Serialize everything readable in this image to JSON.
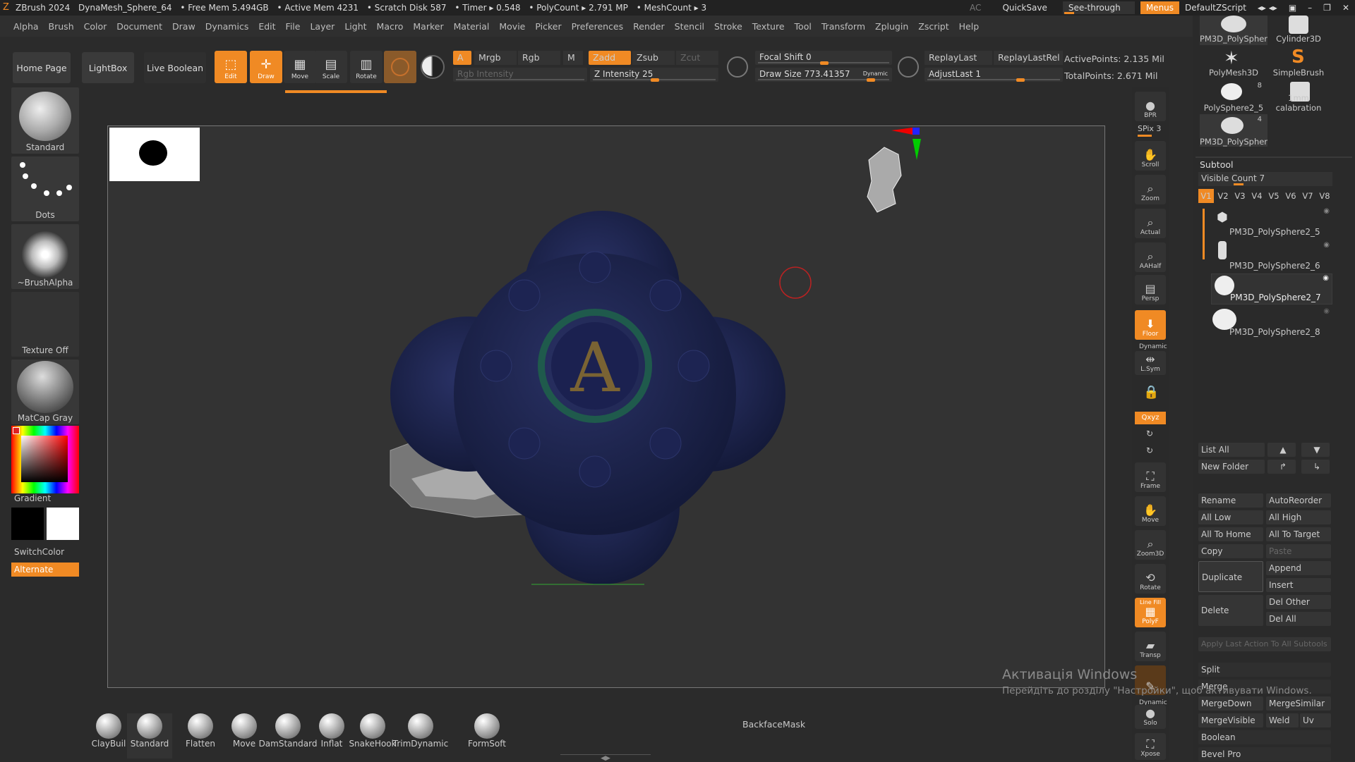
{
  "titlebar": {
    "app": "ZBrush 2024",
    "doc": "DynaMesh_Sphere_64",
    "free_mem": "• Free Mem 5.494GB",
    "active_mem": "• Active Mem 4231",
    "scratch": "• Scratch Disk 587",
    "timer": "• Timer ▸ 0.548",
    "polycount": "• PolyCount ▸ 2.791 MP",
    "meshcount": "• MeshCount ▸ 3",
    "ac": "AC",
    "quicksave": "QuickSave",
    "see_through": "See-through",
    "see_through_value": "0",
    "menus": "Menus",
    "zscript": "DefaultZScript"
  },
  "menu": [
    "Alpha",
    "Brush",
    "Color",
    "Document",
    "Draw",
    "Dynamics",
    "Edit",
    "File",
    "Layer",
    "Light",
    "Macro",
    "Marker",
    "Material",
    "Movie",
    "Picker",
    "Preferences",
    "Render",
    "Stencil",
    "Stroke",
    "Texture",
    "Tool",
    "Transform",
    "Zplugin",
    "Zscript",
    "Help"
  ],
  "shelf": {
    "home": "Home Page",
    "lightbox": "LightBox",
    "liveboolean": "Live Boolean",
    "tools": [
      "Edit",
      "Draw",
      "Move",
      "Scale",
      "Rotate"
    ],
    "a": "A",
    "mrgb": "Mrgb",
    "rgb": "Rgb",
    "m": "M",
    "rgb_intensity": "Rgb Intensity",
    "zadd": "Zadd",
    "zsub": "Zsub",
    "zcut": "Zcut",
    "z_intensity": "Z Intensity 25",
    "focal_shift": "Focal Shift 0",
    "draw_size": "Draw Size 773.41357",
    "dynamic": "Dynamic",
    "replay_last": "ReplayLast",
    "replay_last_rel": "ReplayLastRel",
    "adjust_last": "AdjustLast 1",
    "active_points": "ActivePoints: 2.135 Mil",
    "total_points": "TotalPoints: 2.671 Mil"
  },
  "left": {
    "brush": "Standard",
    "stroke": "Dots",
    "alpha": "~BrushAlpha",
    "texture": "Texture Off",
    "material": "MatCap Gray",
    "gradient": "Gradient",
    "switchcolor": "SwitchColor",
    "alternate": "Alternate"
  },
  "rshelf": [
    "BPR",
    "SPix 3",
    "Scroll",
    "Zoom",
    "Actual",
    "AAHalf",
    "Persp",
    "Floor",
    "L.Sym",
    "Frame",
    "Move",
    "Zoom3D",
    "Rotate",
    "PolyF",
    "Transp",
    "Solo",
    "Xpose"
  ],
  "rshelf_misc": {
    "dynamic": "Dynamic",
    "xyz": "Qxyz",
    "linefill": "Line Fill"
  },
  "tool_thumbs": [
    {
      "label": "PM3D_PolySpher",
      "count": ""
    },
    {
      "label": "Cylinder3D",
      "count": ""
    },
    {
      "label": "PolyMesh3D",
      "count": ""
    },
    {
      "label": "SimpleBrush",
      "count": ""
    },
    {
      "label": "PolySphere2_5",
      "count": "8"
    },
    {
      "label": "1mm calabration",
      "count": ""
    },
    {
      "label": "PM3D_PolySpher",
      "count": "4"
    }
  ],
  "subtool": {
    "title": "Subtool",
    "visible_count": "Visible Count 7",
    "tabs": [
      "V1",
      "V2",
      "V3",
      "V4",
      "V5",
      "V6",
      "V7",
      "V8"
    ],
    "items": [
      "PM3D_PolySphere2_5",
      "PM3D_PolySphere2_6",
      "PM3D_PolySphere2_7",
      "PM3D_PolySphere2_8"
    ],
    "buttons": {
      "list_all": "List All",
      "new_folder": "New Folder",
      "rename": "Rename",
      "autoreorder": "AutoReorder",
      "all_low": "All Low",
      "all_high": "All High",
      "all_to_home": "All To Home",
      "all_to_target": "All To Target",
      "copy": "Copy",
      "paste": "Paste",
      "duplicate": "Duplicate",
      "append": "Append",
      "insert": "Insert",
      "delete": "Delete",
      "del_other": "Del Other",
      "del_all": "Del All",
      "apply_last": "Apply Last Action To All Subtools",
      "split": "Split",
      "merge": "Merge",
      "merge_down": "MergeDown",
      "merge_similar": "MergeSimilar",
      "merge_visible": "MergeVisible",
      "weld": "Weld",
      "uv": "Uv",
      "boolean": "Boolean",
      "bevel_pro": "Bevel Pro"
    }
  },
  "bottom_brushes": [
    "ClayBuil",
    "Standard",
    "Flatten",
    "Move",
    "DamStandard",
    "Inflat",
    "SnakeHook",
    "TrimDynamic",
    "FormSoft"
  ],
  "backface": "BackfaceMask",
  "watermark": {
    "title": "Активація Windows",
    "sub": "Перейдіть до розділу \"Настройки\", щоб активувати Windows."
  },
  "colors": {
    "accent": "#f08a24",
    "bg": "#2b2b2b",
    "viewport": "#333333"
  }
}
